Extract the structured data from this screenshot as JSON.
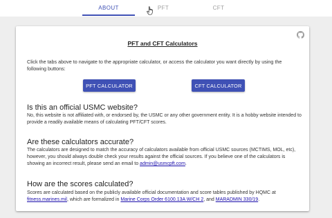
{
  "tabs": [
    {
      "label": "ABOUT",
      "active": true
    },
    {
      "label": "PFT",
      "active": false
    },
    {
      "label": "CFT",
      "active": false
    }
  ],
  "colors": {
    "accent": "#3f51b5",
    "link": "#1a0dab",
    "background": "#eeeeee"
  },
  "card": {
    "icon": "github-icon",
    "title": "PFT and CFT Calculators",
    "intro": "Click the tabs above to navigate to the appropriate calculator, or access the calculator you want directly by using the following buttons:",
    "buttons": {
      "pft": "PFT CALCULATOR",
      "cft": "CFT CALCULATOR"
    },
    "sections": {
      "official": {
        "heading": "Is this an official USMC website?",
        "body": "No, this website is not affiliated with, or endorsed by, the USMC or any other government entity. It is a hobby website intended to provide a readily available means of calculating PFT/CFT scores."
      },
      "accurate": {
        "heading": "Are these calculators accurate?",
        "body": "The calculators are designed to match the accuracy of calculators available from official USMC sources (MCTIMS, MOL, etc), however, you should always double check your results against the official sources. If you believe one of the calculators is showing an incorrect result, please send an email to ",
        "email": "admin@usmcpft.com",
        "end": "."
      },
      "calculated": {
        "heading": "How are the scores calculated?",
        "body_start": "Scores are calculated based on the publicly available official documentation and score tables published by HQMC at ",
        "link1": "fitness.marines.mil",
        "body_mid": ", which are formalized in ",
        "link2": "Marine Corps Order 6100.13A W/CH 2",
        "body_mid2": ", and ",
        "link3": "MARADMIN 330/19",
        "end": "."
      }
    }
  }
}
